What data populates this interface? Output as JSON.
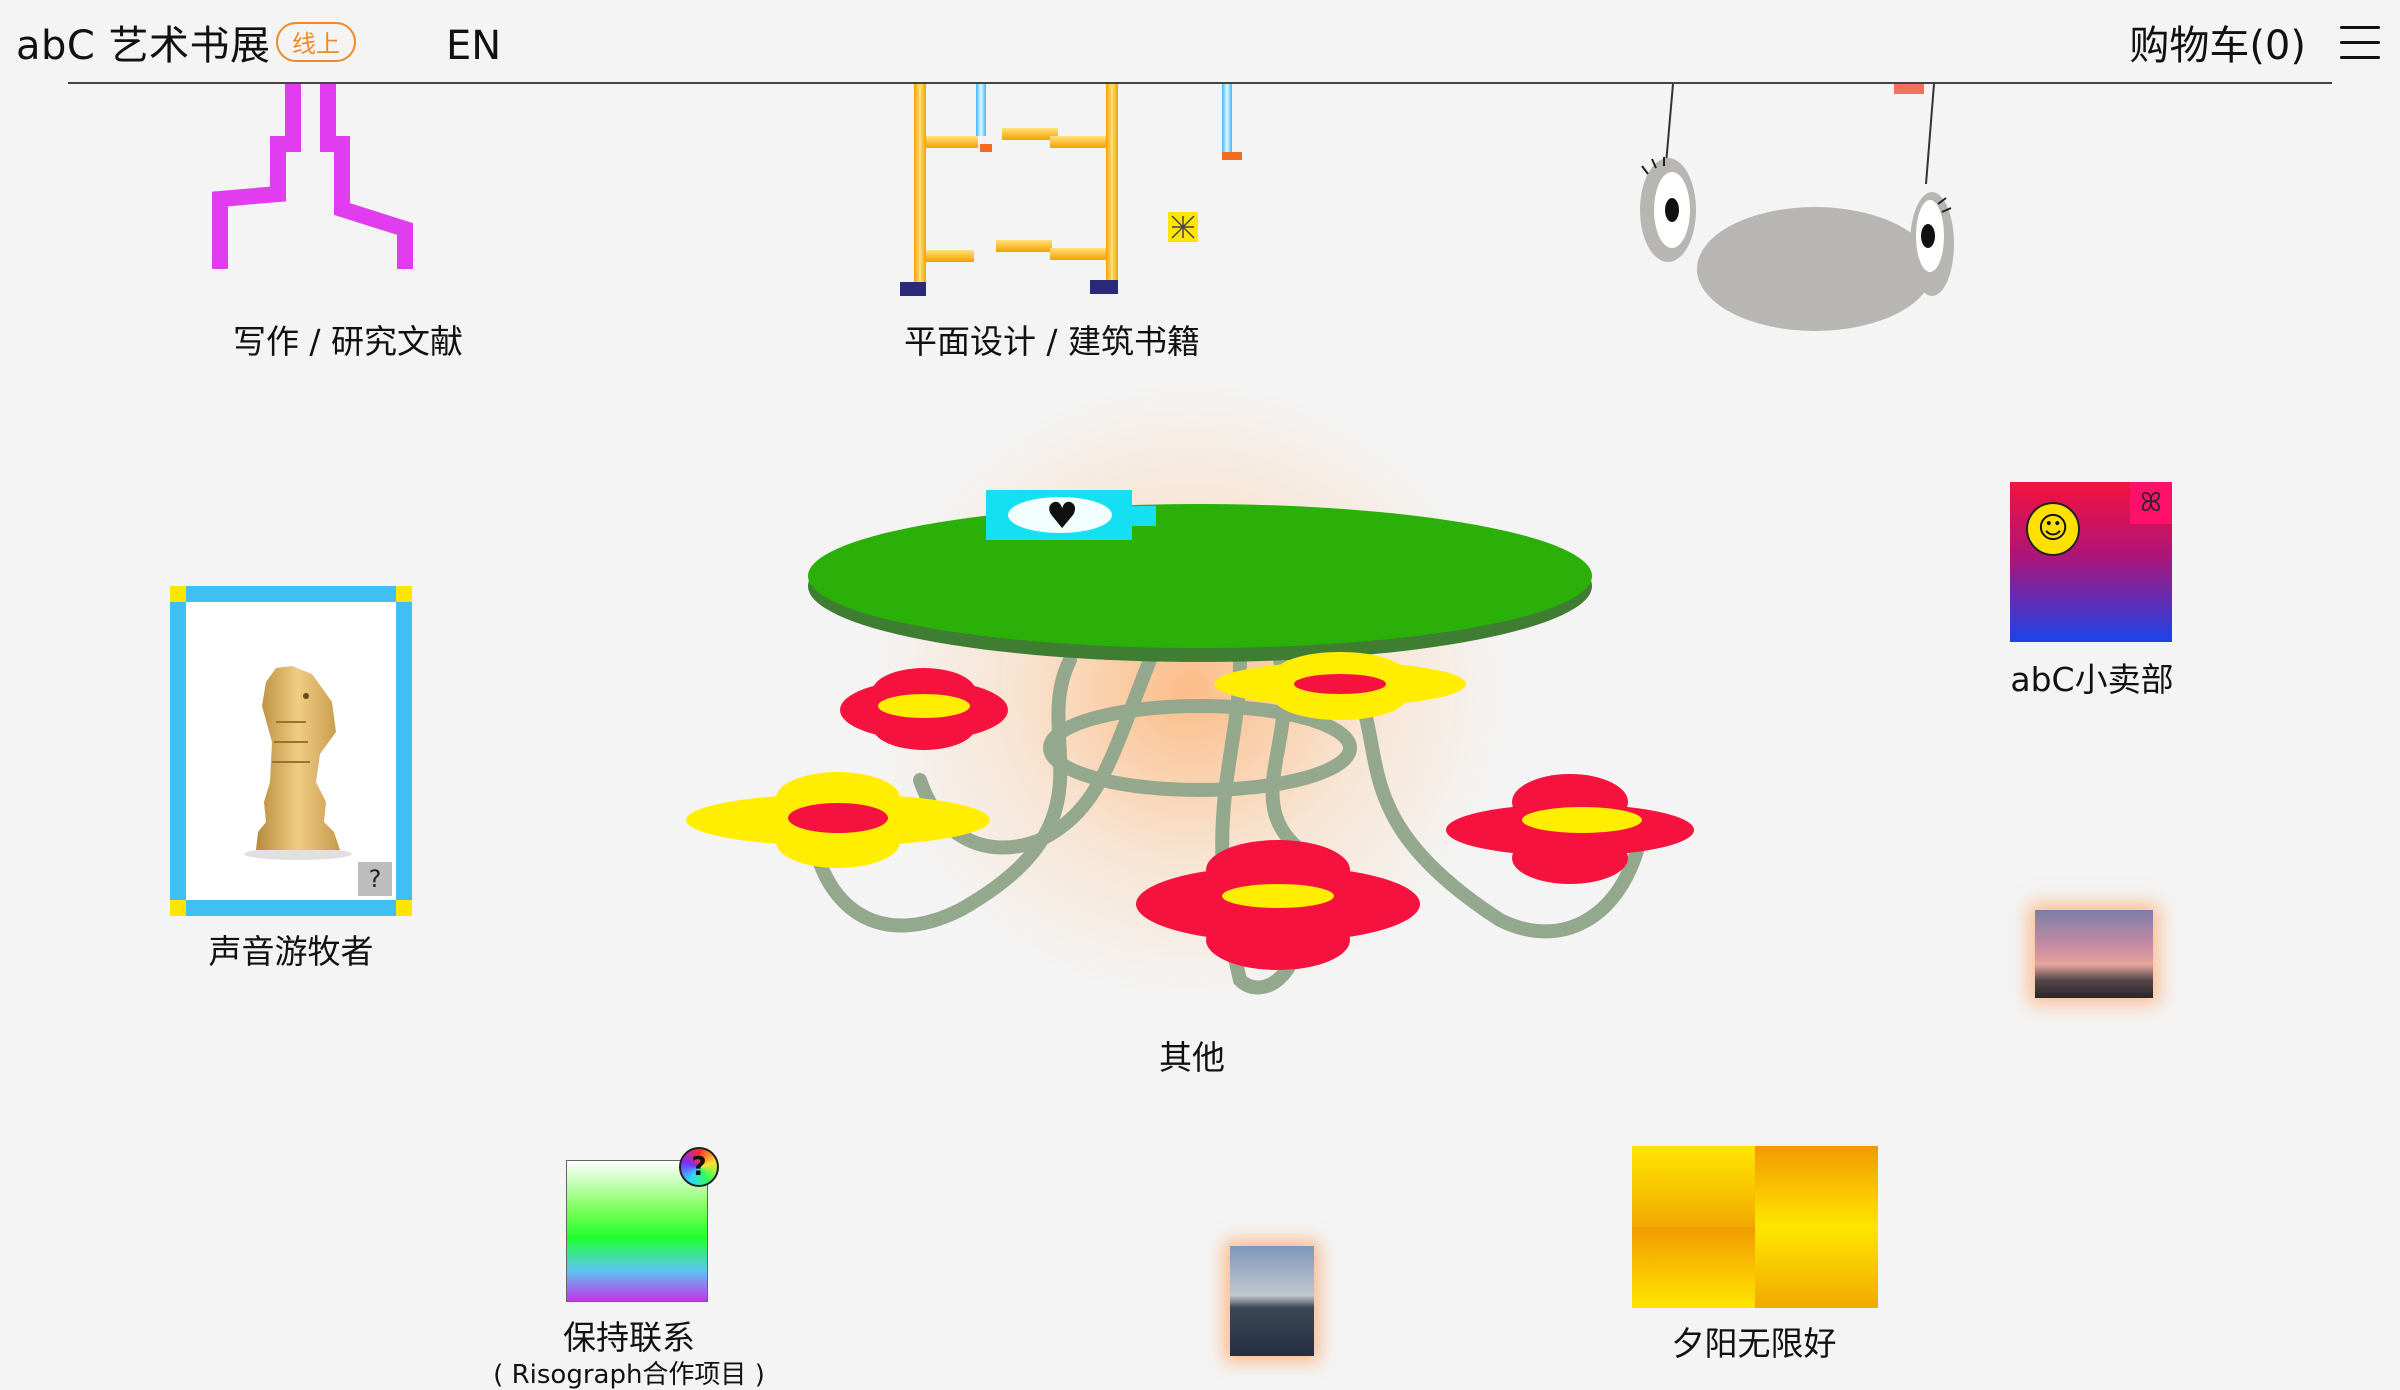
{
  "header": {
    "logo": "abC 艺术书展",
    "badge": "线上",
    "language": "EN",
    "cart": "购物车(0)",
    "menu_icon": "hamburger-menu-icon"
  },
  "items": {
    "writing": {
      "label": "写作 / 研究文献"
    },
    "graphic": {
      "label": "平面设计 / 建筑书籍"
    },
    "sound": {
      "label": "声音游牧者",
      "badge": "?"
    },
    "other": {
      "label": "其他"
    },
    "shop": {
      "label": "abC小卖部"
    },
    "keep": {
      "label": "保持联系",
      "sublabel": "( Risograph合作项目 )",
      "badge": "?"
    },
    "sunset": {
      "label": "夕阳无限好"
    }
  },
  "colors": {
    "accent": "#f08a24",
    "magenta": "#e23cf0",
    "table_green": "#2bb00a",
    "flower_red": "#f5123e",
    "flower_yellow": "#ffee00",
    "frame_blue": "#3fbff2"
  }
}
